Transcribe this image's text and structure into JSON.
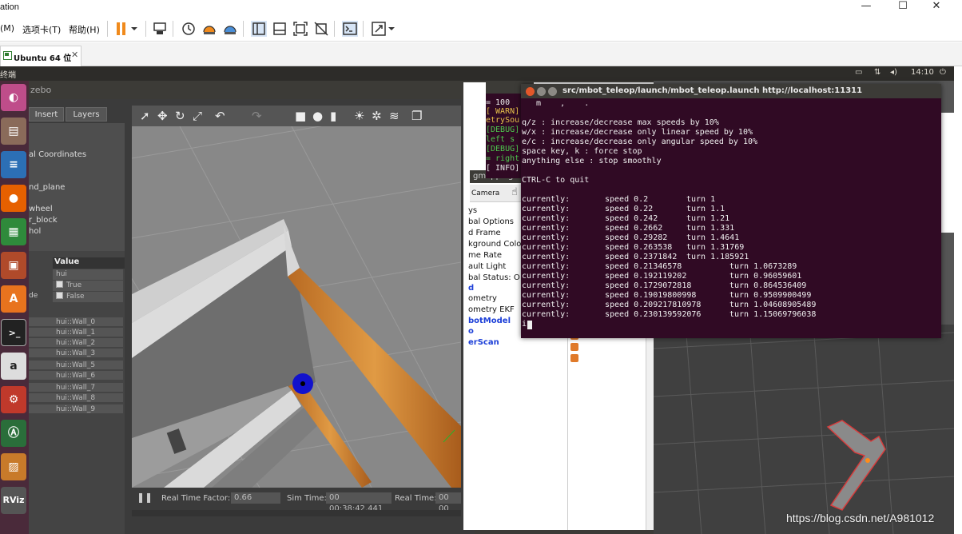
{
  "host": {
    "title_fragment": "ation",
    "menu": [
      "(M)",
      "选项卡(T)",
      "帮助(H)"
    ],
    "tab": "Ubuntu 64 位"
  },
  "ubuntu": {
    "topbar_left": "终端",
    "clock": "14:10"
  },
  "gazebo": {
    "title": "zebo",
    "tabs": [
      "Insert",
      "Layers"
    ],
    "tree": [
      "al Coordinates",
      "nd_plane",
      "wheel",
      "r_block",
      "hol"
    ],
    "prop_header": "Value",
    "props": [
      {
        "key": "",
        "value": "hui",
        "check": false
      },
      {
        "key": "",
        "value": "True",
        "check": true
      },
      {
        "key": "de",
        "value": "False",
        "check": true
      }
    ],
    "walls": [
      "hui::Wall_0",
      "hui::Wall_1",
      "hui::Wall_2",
      "hui::Wall_3",
      "hui::Wall_5",
      "hui::Wall_6",
      "hui::Wall_7",
      "hui::Wall_8",
      "hui::Wall_9"
    ],
    "bottom": {
      "rtf_label": "Real Time Factor:",
      "rtf_value": "0.66",
      "sim_label": "Sim Time:",
      "sim_value": "00 00:38:42.441",
      "real_label": "Real Time:",
      "real_value": "00 00"
    }
  },
  "rviz": {
    "title_fragment": "gmapping.r",
    "camera_label": "Camera",
    "tree": [
      "ys",
      "bal Options",
      "d Frame",
      "kground Colo",
      "me Rate",
      "ault Light",
      "bal Status: O",
      "d",
      "ometry",
      "ometry EKF",
      "botModel",
      "o",
      "erScan"
    ]
  },
  "bg_terminal": [
    {
      "text": "= 100",
      "color": "#eaeaea"
    },
    {
      "text": "[ WARN]",
      "color": "#e6c04a"
    },
    {
      "text": "etrySou",
      "color": "#e6c04a"
    },
    {
      "text": "[DEBUG]",
      "color": "#4ec94e"
    },
    {
      "text": " left s",
      "color": "#4ec94e"
    },
    {
      "text": "[DEBUG]",
      "color": "#4ec94e"
    },
    {
      "text": "= right",
      "color": "#4ec94e"
    },
    {
      "text": "[ INFO]",
      "color": "#eaeaea"
    }
  ],
  "terminal": {
    "title": "src/mbot_teleop/launch/mbot_teleop.launch http://localhost:11311",
    "help_lines": [
      "   m    ,    .",
      "",
      "q/z : increase/decrease max speeds by 10%",
      "w/x : increase/decrease only linear speed by 10%",
      "e/c : increase/decrease only angular speed by 10%",
      "space key, k : force stop",
      "anything else : stop smoothly",
      "",
      "CTRL-C to quit",
      ""
    ],
    "rows": [
      {
        "label": "currently:",
        "speed": "speed 0.2",
        "turn": "turn 1"
      },
      {
        "label": "currently:",
        "speed": "speed 0.22",
        "turn": "turn 1.1"
      },
      {
        "label": "currently:",
        "speed": "speed 0.242",
        "turn": "turn 1.21"
      },
      {
        "label": "currently:",
        "speed": "speed 0.2662",
        "turn": "turn 1.331"
      },
      {
        "label": "currently:",
        "speed": "speed 0.29282",
        "turn": "turn 1.4641"
      },
      {
        "label": "currently:",
        "speed": "speed 0.263538",
        "turn": "turn 1.31769"
      },
      {
        "label": "currently:",
        "speed": "speed 0.2371842",
        "turn": "turn 1.185921"
      },
      {
        "label": "currently:",
        "speed": "speed 0.21346578",
        "turn": "turn 1.0673289"
      },
      {
        "label": "currently:",
        "speed": "speed 0.192119202",
        "turn": "turn 0.96059601"
      },
      {
        "label": "currently:",
        "speed": "speed 0.1729072818",
        "turn": "turn 0.864536409"
      },
      {
        "label": "currently:",
        "speed": "speed 0.19019800998",
        "turn": "turn 0.9509900499"
      },
      {
        "label": "currently:",
        "speed": "speed 0.209217810978",
        "turn": "turn 1.04608905489"
      },
      {
        "label": "currently:",
        "speed": "speed 0.230139592076",
        "turn": "turn 1.15069796038"
      }
    ],
    "prompt": "i"
  },
  "watermark": "https://blog.csdn.net/A981012"
}
